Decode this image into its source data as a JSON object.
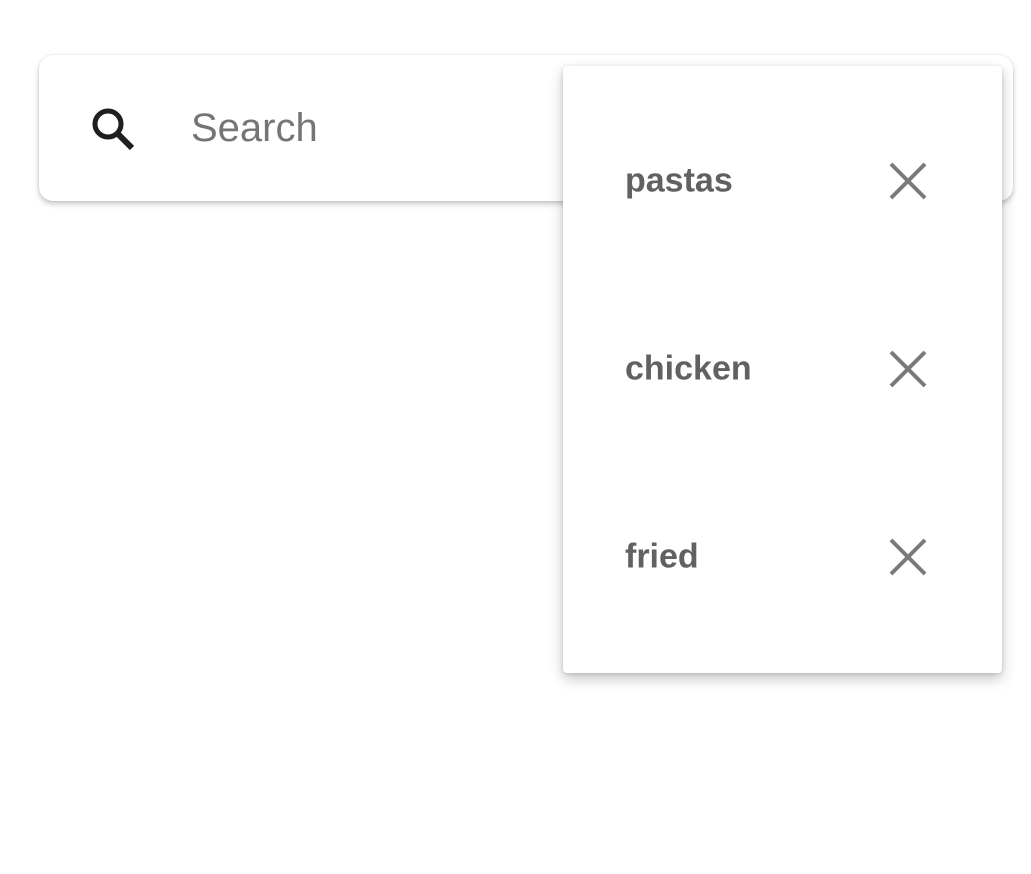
{
  "search": {
    "placeholder": "Search",
    "value": "",
    "icon": "search-icon"
  },
  "history": {
    "items": [
      {
        "label": "pastas",
        "remove_icon": "close-icon"
      },
      {
        "label": "chicken",
        "remove_icon": "close-icon"
      },
      {
        "label": "fried",
        "remove_icon": "close-icon"
      }
    ]
  },
  "colors": {
    "background": "#ffffff",
    "label": "#616161",
    "icon_dark": "#1f1f1f",
    "icon_close": "#7a7a7a",
    "placeholder": "#757575"
  }
}
